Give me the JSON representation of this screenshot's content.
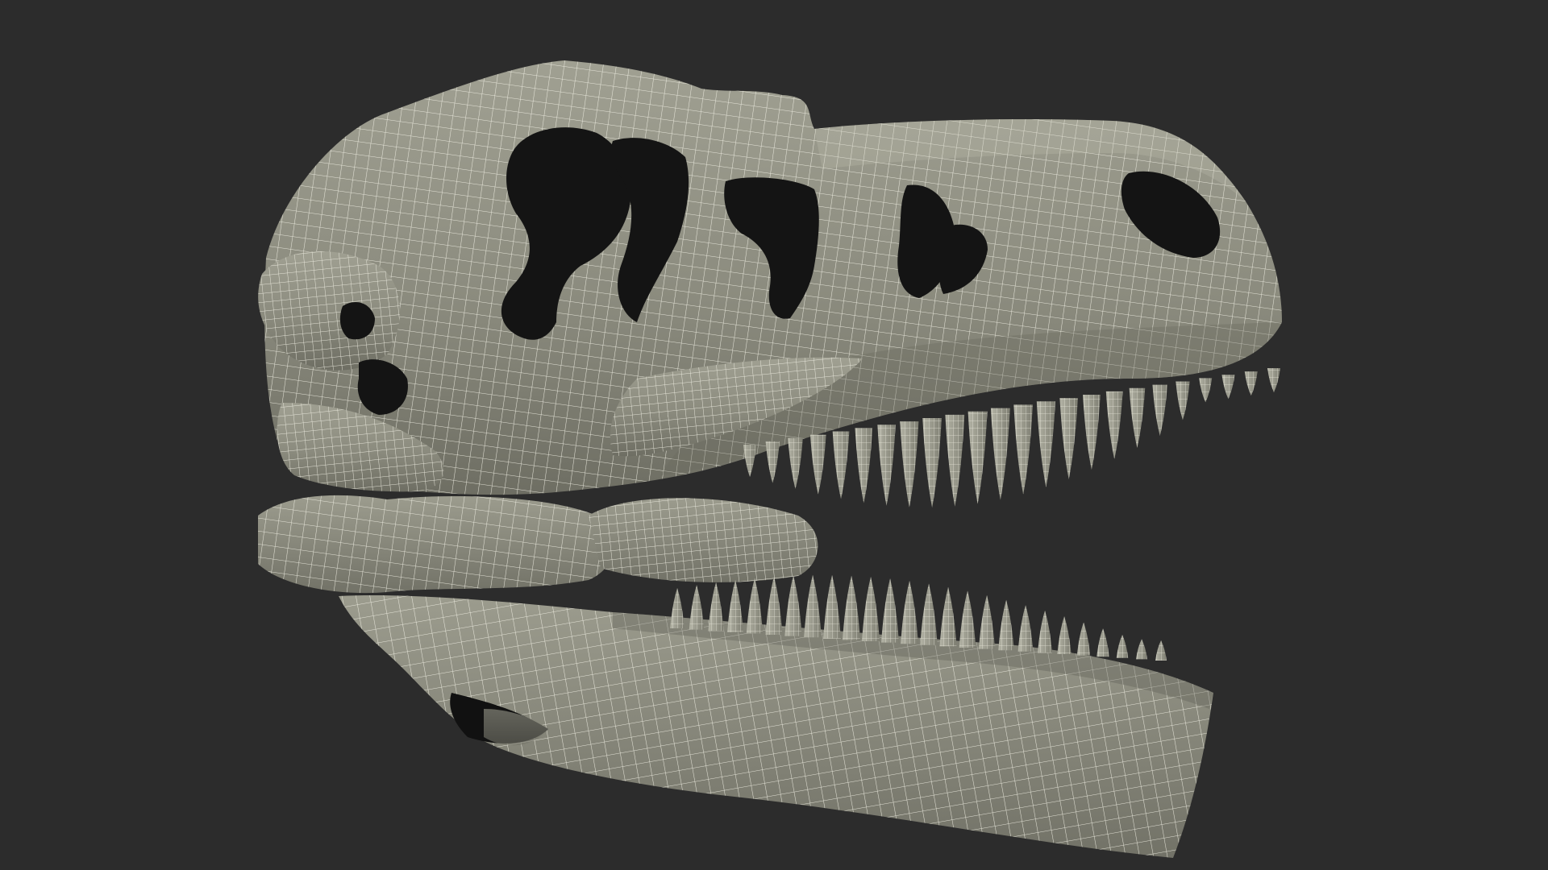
{
  "scene": {
    "subject": "dinosaur-skull-wireframe",
    "render_mode": "wireframe-shaded",
    "colors": {
      "background": "#2c2c2c",
      "mesh_fill": "#8a8a7c",
      "mesh_fill_light": "#a3a395",
      "mesh_fill_dark": "#6c6c61",
      "wire": "#f4f2e6",
      "cavity": "#121212"
    },
    "upper_teeth_count": 24,
    "lower_teeth_count": 26
  }
}
